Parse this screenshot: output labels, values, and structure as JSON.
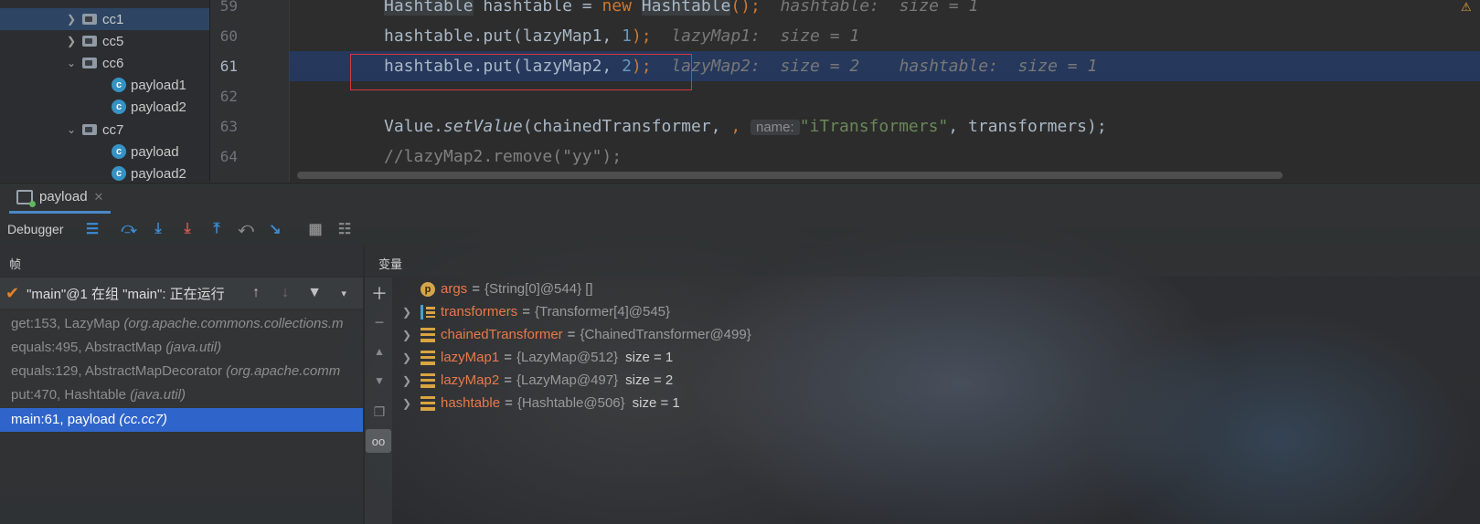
{
  "project_tree": {
    "items": [
      {
        "label": "cc1",
        "kind": "package",
        "expanded": false
      },
      {
        "label": "cc5",
        "kind": "package",
        "expanded": false
      },
      {
        "label": "cc6",
        "kind": "package",
        "expanded": true
      },
      {
        "label": "payload1",
        "kind": "class"
      },
      {
        "label": "payload2",
        "kind": "class"
      },
      {
        "label": "cc7",
        "kind": "package",
        "expanded": true
      },
      {
        "label": "payload",
        "kind": "class"
      },
      {
        "label": "payload2",
        "kind": "class"
      }
    ]
  },
  "editor": {
    "current_line": 61,
    "lines": [
      {
        "number": "59",
        "t1": "Hashtable",
        "t2": " hashtable = ",
        "t3": "new",
        "t4": "Hashtable",
        "t5": "();",
        "hint": "hashtable:  size = 1"
      },
      {
        "number": "60",
        "t1": "hashtable.put(lazyMap1, ",
        "t2": "1",
        "t3": ");",
        "hint": "lazyMap1:  size = 1"
      },
      {
        "number": "61",
        "t1": "hashtable.put(lazyMap2, ",
        "t2": "2",
        "t3": ");",
        "hint": "lazyMap2:  size = 2    hashtable:  size = 1"
      },
      {
        "number": "62"
      },
      {
        "number": "63",
        "t1": "Value.",
        "t2": "setValue",
        "t3": "(chainedTransformer, ",
        "param_hint": "name:",
        "t4": "\"iTransformers\"",
        "t5": ", transformers);"
      },
      {
        "number": "64",
        "t1": "//lazyMap2.remove(\"yy\");"
      }
    ],
    "warning_icon": "⚠"
  },
  "debug": {
    "tab_label": "payload",
    "toolbar_label": "Debugger",
    "frames_title": "帧",
    "variables_title": "变量",
    "thread": "\"main\"@1 在组 \"main\": 正在运行",
    "frames": [
      {
        "method": "get:153, LazyMap",
        "pkg": "(org.apache.commons.collections.m"
      },
      {
        "method": "equals:495, AbstractMap",
        "pkg": "(java.util)"
      },
      {
        "method": "equals:129, AbstractMapDecorator",
        "pkg": "(org.apache.comm"
      },
      {
        "method": "put:470, Hashtable",
        "pkg": "(java.util)"
      },
      {
        "method": "main:61, payload",
        "pkg": "(cc.cc7)",
        "selected": true
      }
    ],
    "variables": [
      {
        "name": "args",
        "value": "{String[0]@544} []",
        "extra": "",
        "icon": "param-icon",
        "expandable": false
      },
      {
        "name": "transformers",
        "value": "{Transformer[4]@545}",
        "extra": "",
        "icon": "array-icon",
        "expandable": true
      },
      {
        "name": "chainedTransformer",
        "value": "{ChainedTransformer@499}",
        "extra": "",
        "icon": "field-icon",
        "expandable": true
      },
      {
        "name": "lazyMap1",
        "value": "{LazyMap@512}",
        "extra": "size = 1",
        "icon": "field-icon",
        "expandable": true
      },
      {
        "name": "lazyMap2",
        "value": "{LazyMap@497}",
        "extra": "size = 2",
        "icon": "field-icon",
        "expandable": true
      },
      {
        "name": "hashtable",
        "value": "{Hashtable@506}",
        "extra": "size = 1",
        "icon": "field-icon",
        "expandable": true
      }
    ]
  },
  "colors": {
    "keyword": "#cc7832",
    "number": "#6897bb",
    "string": "#6a8759",
    "variable_name": "#e8794a",
    "selection": "#2f65ca",
    "current_line": "#214283",
    "breakpoint_box": "#d0393e"
  }
}
